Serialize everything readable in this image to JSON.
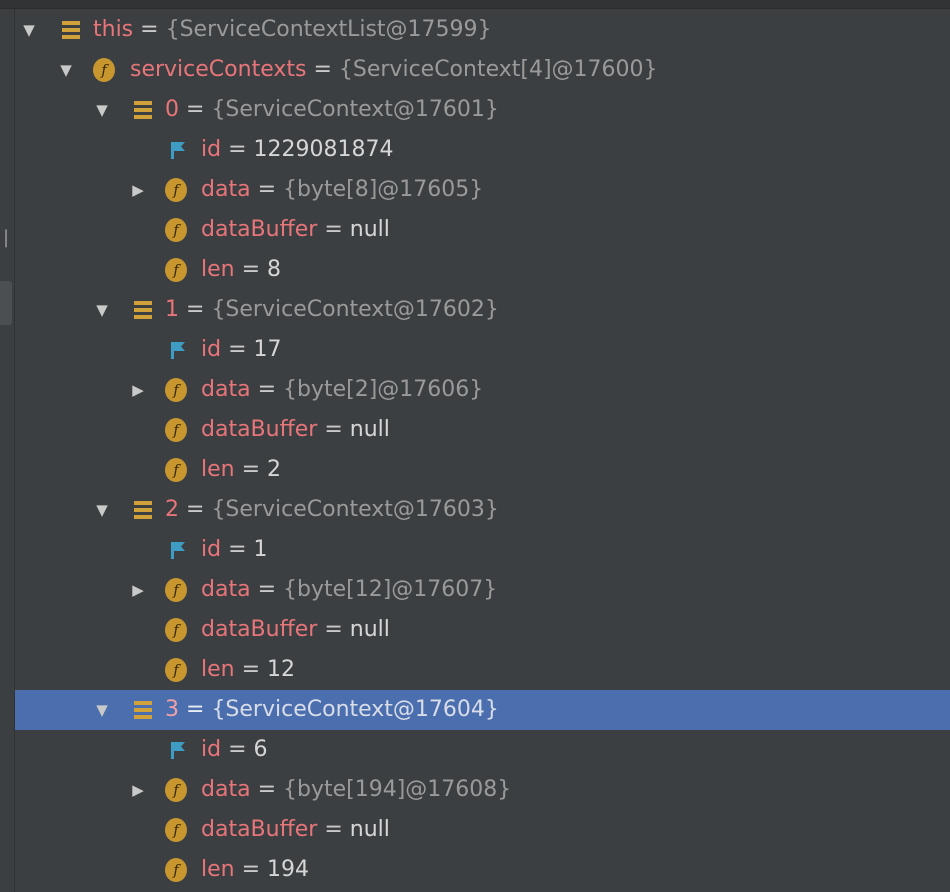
{
  "colors": {
    "background": "#3c3f41",
    "selection": "#4b6eaf",
    "name": "#e8757a",
    "object_value": "#9a9a9a",
    "plain_value": "#d6d6d6",
    "field_icon": "#c8962f",
    "list_icon": "#d1a13a",
    "id_flag_icon": "#3e9bc4"
  },
  "tree": {
    "root": {
      "name": "this",
      "eq": "=",
      "value": "{ServiceContextList@17599}",
      "icon": "list-icon",
      "expanded": true
    },
    "service_contexts": {
      "name": "serviceContexts",
      "eq": "=",
      "value": "{ServiceContext[4]@17600}",
      "icon": "field-icon",
      "expanded": true
    },
    "items": [
      {
        "name": "0",
        "eq": "=",
        "value": "{ServiceContext@17601}",
        "expanded": true,
        "selected": false,
        "id": {
          "name": "id",
          "eq": "=",
          "value": "1229081874"
        },
        "data": {
          "name": "data",
          "eq": "=",
          "value": "{byte[8]@17605}"
        },
        "dataBuffer": {
          "name": "dataBuffer",
          "eq": "=",
          "value": "null"
        },
        "len": {
          "name": "len",
          "eq": "=",
          "value": "8"
        }
      },
      {
        "name": "1",
        "eq": "=",
        "value": "{ServiceContext@17602}",
        "expanded": true,
        "selected": false,
        "id": {
          "name": "id",
          "eq": "=",
          "value": "17"
        },
        "data": {
          "name": "data",
          "eq": "=",
          "value": "{byte[2]@17606}"
        },
        "dataBuffer": {
          "name": "dataBuffer",
          "eq": "=",
          "value": "null"
        },
        "len": {
          "name": "len",
          "eq": "=",
          "value": "2"
        }
      },
      {
        "name": "2",
        "eq": "=",
        "value": "{ServiceContext@17603}",
        "expanded": true,
        "selected": false,
        "id": {
          "name": "id",
          "eq": "=",
          "value": "1"
        },
        "data": {
          "name": "data",
          "eq": "=",
          "value": "{byte[12]@17607}"
        },
        "dataBuffer": {
          "name": "dataBuffer",
          "eq": "=",
          "value": "null"
        },
        "len": {
          "name": "len",
          "eq": "=",
          "value": "12"
        }
      },
      {
        "name": "3",
        "eq": "=",
        "value": "{ServiceContext@17604}",
        "expanded": true,
        "selected": true,
        "id": {
          "name": "id",
          "eq": "=",
          "value": "6"
        },
        "data": {
          "name": "data",
          "eq": "=",
          "value": "{byte[194]@17608}"
        },
        "dataBuffer": {
          "name": "dataBuffer",
          "eq": "=",
          "value": "null"
        },
        "len": {
          "name": "len",
          "eq": "=",
          "value": "194"
        }
      }
    ]
  }
}
